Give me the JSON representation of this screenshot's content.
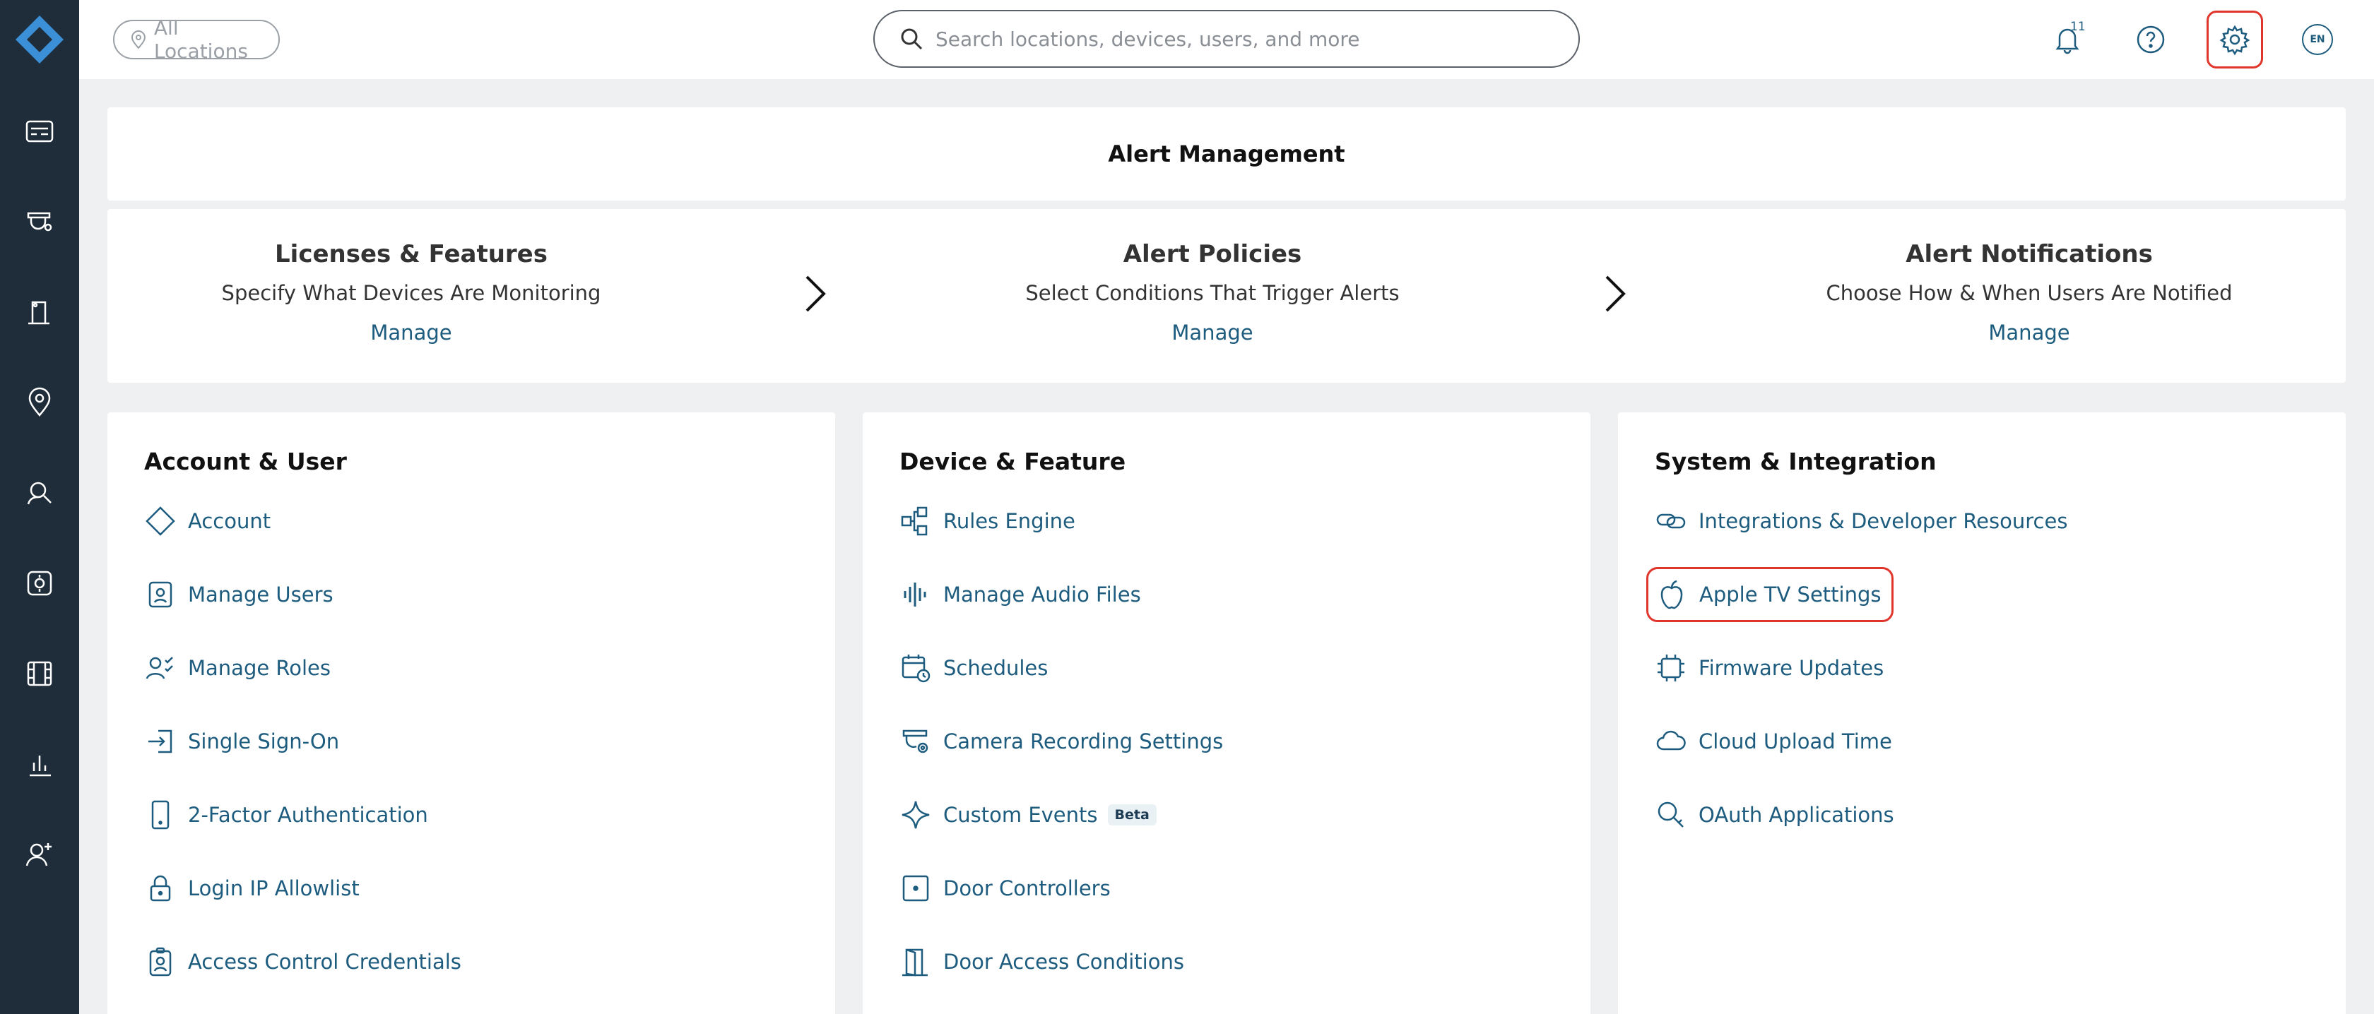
{
  "topbar": {
    "location_filter": "All Locations",
    "search_placeholder": "Search locations, devices, users, and more",
    "notification_count": "11",
    "language": "EN"
  },
  "alert_management": {
    "title": "Alert Management",
    "steps": [
      {
        "title": "Licenses & Features",
        "subtitle": "Specify What Devices Are Monitoring",
        "link": "Manage"
      },
      {
        "title": "Alert Policies",
        "subtitle": "Select Conditions That Trigger Alerts",
        "link": "Manage"
      },
      {
        "title": "Alert Notifications",
        "subtitle": "Choose How & When Users Are Notified",
        "link": "Manage"
      }
    ]
  },
  "sections": {
    "account": {
      "title": "Account & User",
      "items": [
        "Account",
        "Manage Users",
        "Manage Roles",
        "Single Sign-On",
        "2-Factor Authentication",
        "Login IP Allowlist",
        "Access Control Credentials"
      ]
    },
    "device": {
      "title": "Device & Feature",
      "items": [
        "Rules Engine",
        "Manage Audio Files",
        "Schedules",
        "Camera Recording Settings",
        "Custom Events",
        "Door Controllers",
        "Door Access Conditions"
      ],
      "beta_label": "Beta"
    },
    "system": {
      "title": "System & Integration",
      "items": [
        "Integrations & Developer Resources",
        "Apple TV Settings",
        "Firmware Updates",
        "Cloud Upload Time",
        "OAuth Applications"
      ]
    }
  },
  "colors": {
    "sidebar": "#1f2d3a",
    "link": "#1d5c7e",
    "highlight": "#e0352b"
  }
}
